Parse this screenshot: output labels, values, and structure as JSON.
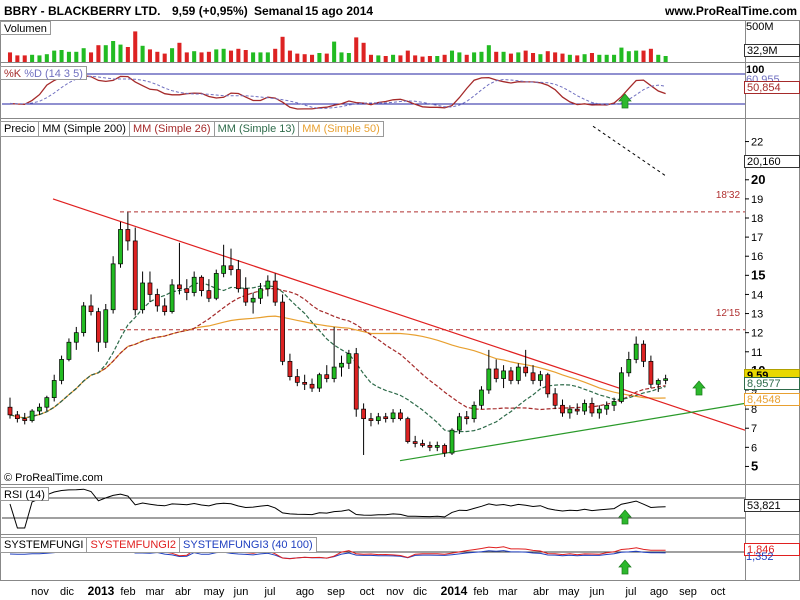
{
  "header": {
    "symbol": "BBRY - BLACKBERRY LTD.",
    "quote": "9,59 (+0,95%)",
    "period": "Semanal",
    "date": "15 ago 2014",
    "site": "www.ProRealTime.com",
    "copyright": "© ProRealTime.com"
  },
  "volume_panel": {
    "label": "Volumen",
    "axis_top": "500M",
    "current": "32,9M"
  },
  "stoch_panel": {
    "k_label": "%K",
    "d_label": "%D (14 3 5)",
    "axis_top": "100",
    "value1": "60,955",
    "value2": "50,854"
  },
  "price_panel": {
    "legend": [
      {
        "text": "Precio",
        "color": "#000000"
      },
      {
        "text": "MM (Simple 200)",
        "color": "#000000"
      },
      {
        "text": "MM (Simple 26)",
        "color": "#a52a2a"
      },
      {
        "text": "MM (Simple 13)",
        "color": "#2e6b4a"
      },
      {
        "text": "MM (Simple 50)",
        "color": "#e8a030"
      }
    ],
    "level_high": "18'32",
    "level_mid": "12'15",
    "tag_ma200": "20,160",
    "tag_price": "9,59",
    "tag_ma13": "8,9577",
    "tag_ma50": "8,4548"
  },
  "rsi_panel": {
    "label": "RSI (14)",
    "value": "53,821"
  },
  "sys_panel": {
    "label1": "SYSTEMFUNGI",
    "label2": "SYSTEMFUNGI2",
    "label3": "SYSTEMFUNGI3 (40 100)",
    "value1": "1,846",
    "value2": "1,352"
  },
  "colors": {
    "up": "#22bb22",
    "down": "#dd2222",
    "trend_down": "#e02020",
    "trend_up": "#2a9a2a",
    "ma13": "#2e6b4a",
    "ma26": "#a52a2a",
    "ma50": "#e8a030",
    "stoch_k": "#a52a2a",
    "stoch_d": "#7070c0",
    "rsi": "#000000"
  },
  "x_labels": [
    "nov",
    "dic",
    "2013",
    "feb",
    "mar",
    "abr",
    "may",
    "jun",
    "jul",
    "ago",
    "sep",
    "oct",
    "nov",
    "dic",
    "2014",
    "feb",
    "mar",
    "abr",
    "may",
    "jun",
    "jul",
    "ago",
    "sep",
    "oct"
  ],
  "chart_data": {
    "type": "candlestick",
    "period": "weekly",
    "y_ticks": [
      5,
      6,
      7,
      8,
      9,
      10,
      11,
      12,
      13,
      14,
      15,
      16,
      17,
      18,
      19,
      20,
      21,
      22
    ],
    "ylim": [
      4.5,
      22.5
    ],
    "x_start": "2012-10-19",
    "candles": [
      [
        8.1,
        8.6,
        7.5,
        7.7
      ],
      [
        7.7,
        7.9,
        7.3,
        7.5
      ],
      [
        7.5,
        7.8,
        7.2,
        7.4
      ],
      [
        7.4,
        8.0,
        7.3,
        7.9
      ],
      [
        7.9,
        8.3,
        7.7,
        8.1
      ],
      [
        8.1,
        8.7,
        7.9,
        8.6
      ],
      [
        8.6,
        9.8,
        8.4,
        9.5
      ],
      [
        9.5,
        10.8,
        9.3,
        10.6
      ],
      [
        10.6,
        11.7,
        10.5,
        11.5
      ],
      [
        11.5,
        12.3,
        11.1,
        12.0
      ],
      [
        12.0,
        13.6,
        11.8,
        13.4
      ],
      [
        13.4,
        14.0,
        12.9,
        13.1
      ],
      [
        13.1,
        13.3,
        11.0,
        11.5
      ],
      [
        11.5,
        13.5,
        11.2,
        13.2
      ],
      [
        13.2,
        16.0,
        13.0,
        15.6
      ],
      [
        15.6,
        17.8,
        15.4,
        17.4
      ],
      [
        17.4,
        18.3,
        16.3,
        16.8
      ],
      [
        16.8,
        17.5,
        12.9,
        13.2
      ],
      [
        13.2,
        15.2,
        13.0,
        14.6
      ],
      [
        14.6,
        15.2,
        13.6,
        14.0
      ],
      [
        14.0,
        14.3,
        13.1,
        13.4
      ],
      [
        13.4,
        13.8,
        12.9,
        13.1
      ],
      [
        13.1,
        14.8,
        13.0,
        14.5
      ],
      [
        14.5,
        16.7,
        14.0,
        14.3
      ],
      [
        14.3,
        14.8,
        13.7,
        14.1
      ],
      [
        14.1,
        15.2,
        13.9,
        14.9
      ],
      [
        14.9,
        15.0,
        13.9,
        14.2
      ],
      [
        14.2,
        14.8,
        13.6,
        13.8
      ],
      [
        13.8,
        15.3,
        13.7,
        15.1
      ],
      [
        15.1,
        16.6,
        14.9,
        15.5
      ],
      [
        15.5,
        16.4,
        15.0,
        15.3
      ],
      [
        15.3,
        15.8,
        14.1,
        14.3
      ],
      [
        14.3,
        14.9,
        13.4,
        13.6
      ],
      [
        13.6,
        14.1,
        13.0,
        13.8
      ],
      [
        13.8,
        14.6,
        13.5,
        14.3
      ],
      [
        14.3,
        15.0,
        13.9,
        14.7
      ],
      [
        14.7,
        15.1,
        13.4,
        13.6
      ],
      [
        13.6,
        14.0,
        10.3,
        10.5
      ],
      [
        10.5,
        10.9,
        9.5,
        9.7
      ],
      [
        9.7,
        10.1,
        9.2,
        9.4
      ],
      [
        9.4,
        9.8,
        9.0,
        9.3
      ],
      [
        9.3,
        9.6,
        8.9,
        9.1
      ],
      [
        9.1,
        9.9,
        8.9,
        9.8
      ],
      [
        9.8,
        10.3,
        9.4,
        9.6
      ],
      [
        9.6,
        12.3,
        9.4,
        10.2
      ],
      [
        10.2,
        10.8,
        9.7,
        10.4
      ],
      [
        10.4,
        11.1,
        10.1,
        10.9
      ],
      [
        10.9,
        11.2,
        7.6,
        8.0
      ],
      [
        8.0,
        8.3,
        5.6,
        7.5
      ],
      [
        7.5,
        7.8,
        7.1,
        7.4
      ],
      [
        7.4,
        7.8,
        7.2,
        7.6
      ],
      [
        7.6,
        7.8,
        7.3,
        7.5
      ],
      [
        7.5,
        8.0,
        7.3,
        7.8
      ],
      [
        7.8,
        8.0,
        7.4,
        7.5
      ],
      [
        7.5,
        7.6,
        6.2,
        6.3
      ],
      [
        6.3,
        6.6,
        6.0,
        6.2
      ],
      [
        6.2,
        6.4,
        6.0,
        6.1
      ],
      [
        6.1,
        6.3,
        5.8,
        6.0
      ],
      [
        6.0,
        6.3,
        5.8,
        6.1
      ],
      [
        6.1,
        6.2,
        5.5,
        5.7
      ],
      [
        5.7,
        7.0,
        5.6,
        6.9
      ],
      [
        6.9,
        7.8,
        6.7,
        7.6
      ],
      [
        7.6,
        7.9,
        7.2,
        7.5
      ],
      [
        7.5,
        8.4,
        7.3,
        8.2
      ],
      [
        8.2,
        9.2,
        8.0,
        9.0
      ],
      [
        9.0,
        11.1,
        8.8,
        10.1
      ],
      [
        10.1,
        10.6,
        9.4,
        9.6
      ],
      [
        9.6,
        10.3,
        9.1,
        10.0
      ],
      [
        10.0,
        10.2,
        9.3,
        9.5
      ],
      [
        9.5,
        10.4,
        9.3,
        10.2
      ],
      [
        10.2,
        11.1,
        9.7,
        9.9
      ],
      [
        9.9,
        10.3,
        9.3,
        9.5
      ],
      [
        9.5,
        10.0,
        9.2,
        9.8
      ],
      [
        9.8,
        9.9,
        8.6,
        8.8
      ],
      [
        8.8,
        9.1,
        8.0,
        8.2
      ],
      [
        8.2,
        8.5,
        7.6,
        7.8
      ],
      [
        7.8,
        8.2,
        7.5,
        8.0
      ],
      [
        8.0,
        8.3,
        7.7,
        7.9
      ],
      [
        7.9,
        8.5,
        7.7,
        8.3
      ],
      [
        8.3,
        8.6,
        7.6,
        7.8
      ],
      [
        7.8,
        8.2,
        7.5,
        8.0
      ],
      [
        8.0,
        8.4,
        7.7,
        8.2
      ],
      [
        8.2,
        8.6,
        7.9,
        8.4
      ],
      [
        8.4,
        10.2,
        8.3,
        9.9
      ],
      [
        9.9,
        11.0,
        9.7,
        10.6
      ],
      [
        10.6,
        11.8,
        10.4,
        11.4
      ],
      [
        11.4,
        11.6,
        10.2,
        10.5
      ],
      [
        10.5,
        10.8,
        9.1,
        9.3
      ],
      [
        9.3,
        9.6,
        8.9,
        9.5
      ],
      [
        9.5,
        9.8,
        9.3,
        9.59
      ]
    ]
  }
}
